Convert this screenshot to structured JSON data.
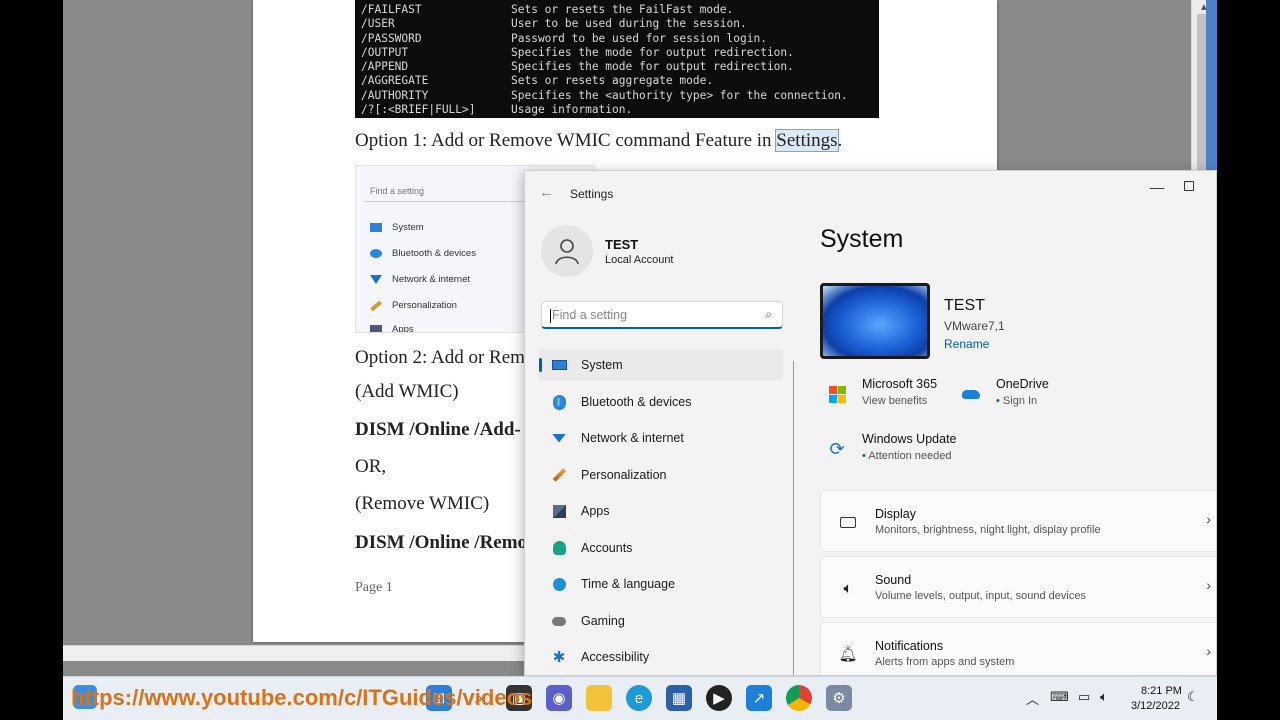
{
  "cmd_lines": [
    {
      "switch": "/FAILFAST",
      "desc": "Sets or resets the FailFast mode."
    },
    {
      "switch": "/USER",
      "desc": "User to be used during the session."
    },
    {
      "switch": "/PASSWORD",
      "desc": "Password to be used for session login."
    },
    {
      "switch": "/OUTPUT",
      "desc": "Specifies the mode for output redirection."
    },
    {
      "switch": "/APPEND",
      "desc": "Specifies the mode for output redirection."
    },
    {
      "switch": "/AGGREGATE",
      "desc": "Sets or resets aggregate mode."
    },
    {
      "switch": "/AUTHORITY",
      "desc": "Specifies the <authority type> for the connection."
    },
    {
      "switch": "/?[:<BRIEF|FULL>]",
      "desc": "Usage information."
    }
  ],
  "document": {
    "option1_prefix": "Option 1: Add or Remove WMIC command Feature in ",
    "option1_highlight": "Settings",
    "option1_suffix": ".",
    "thumb_search": "Find a setting",
    "thumb_items": [
      "System",
      "Bluetooth & devices",
      "Network & internet",
      "Personalization",
      "Apps"
    ],
    "option2": "Option 2: Add or Rem",
    "add_wmic": "(Add WMIC)",
    "dism_add": "DISM /Online /Add-",
    "or": "OR,",
    "remove_wmic": "(Remove WMIC)",
    "dism_remove": "DISM /Online /Remo",
    "page": "Page 1"
  },
  "settings": {
    "window_title": "Settings",
    "user_name": "TEST",
    "user_type": "Local Account",
    "search_placeholder": "Find a setting",
    "nav": [
      {
        "label": "System",
        "icon": "monitor-icon",
        "selected": true
      },
      {
        "label": "Bluetooth & devices",
        "icon": "bluetooth-icon"
      },
      {
        "label": "Network & internet",
        "icon": "wifi-icon"
      },
      {
        "label": "Personalization",
        "icon": "brush-icon"
      },
      {
        "label": "Apps",
        "icon": "apps-icon"
      },
      {
        "label": "Accounts",
        "icon": "accounts-icon"
      },
      {
        "label": "Time & language",
        "icon": "globe-clock-icon"
      },
      {
        "label": "Gaming",
        "icon": "gamepad-icon"
      },
      {
        "label": "Accessibility",
        "icon": "accessibility-icon"
      }
    ],
    "page_title": "System",
    "device_name": "TEST",
    "device_model": "VMware7,1",
    "rename": "Rename",
    "ms365_title": "Microsoft 365",
    "ms365_sub": "View benefits",
    "onedrive_title": "OneDrive",
    "onedrive_sub": "Sign In",
    "wu_title": "Windows Update",
    "wu_sub": "Attention needed",
    "cards": [
      {
        "title": "Display",
        "sub": "Monitors, brightness, night light, display profile",
        "icon": "display-icon"
      },
      {
        "title": "Sound",
        "sub": "Volume levels, output, input, sound devices",
        "icon": "speaker-icon"
      },
      {
        "title": "Notifications",
        "sub": "Alerts from apps and system",
        "icon": "bell-icon"
      }
    ]
  },
  "taskbar": {
    "url_overlay": "https://www.youtube.com/c/ITGuides/videos",
    "time": "8:21 PM",
    "date": "3/12/2022"
  },
  "colors": {
    "accent": "#005fb8",
    "url_orange": "#d9731a"
  }
}
